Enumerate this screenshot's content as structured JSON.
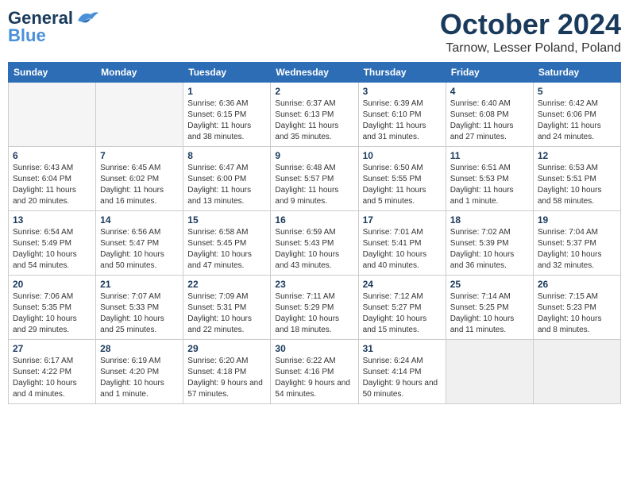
{
  "logo": {
    "line1": "General",
    "line2": "Blue"
  },
  "title": "October 2024",
  "location": "Tarnow, Lesser Poland, Poland",
  "days_of_week": [
    "Sunday",
    "Monday",
    "Tuesday",
    "Wednesday",
    "Thursday",
    "Friday",
    "Saturday"
  ],
  "weeks": [
    [
      {
        "day": "",
        "info": ""
      },
      {
        "day": "",
        "info": ""
      },
      {
        "day": "1",
        "info": "Sunrise: 6:36 AM\nSunset: 6:15 PM\nDaylight: 11 hours and 38 minutes."
      },
      {
        "day": "2",
        "info": "Sunrise: 6:37 AM\nSunset: 6:13 PM\nDaylight: 11 hours and 35 minutes."
      },
      {
        "day": "3",
        "info": "Sunrise: 6:39 AM\nSunset: 6:10 PM\nDaylight: 11 hours and 31 minutes."
      },
      {
        "day": "4",
        "info": "Sunrise: 6:40 AM\nSunset: 6:08 PM\nDaylight: 11 hours and 27 minutes."
      },
      {
        "day": "5",
        "info": "Sunrise: 6:42 AM\nSunset: 6:06 PM\nDaylight: 11 hours and 24 minutes."
      }
    ],
    [
      {
        "day": "6",
        "info": "Sunrise: 6:43 AM\nSunset: 6:04 PM\nDaylight: 11 hours and 20 minutes."
      },
      {
        "day": "7",
        "info": "Sunrise: 6:45 AM\nSunset: 6:02 PM\nDaylight: 11 hours and 16 minutes."
      },
      {
        "day": "8",
        "info": "Sunrise: 6:47 AM\nSunset: 6:00 PM\nDaylight: 11 hours and 13 minutes."
      },
      {
        "day": "9",
        "info": "Sunrise: 6:48 AM\nSunset: 5:57 PM\nDaylight: 11 hours and 9 minutes."
      },
      {
        "day": "10",
        "info": "Sunrise: 6:50 AM\nSunset: 5:55 PM\nDaylight: 11 hours and 5 minutes."
      },
      {
        "day": "11",
        "info": "Sunrise: 6:51 AM\nSunset: 5:53 PM\nDaylight: 11 hours and 1 minute."
      },
      {
        "day": "12",
        "info": "Sunrise: 6:53 AM\nSunset: 5:51 PM\nDaylight: 10 hours and 58 minutes."
      }
    ],
    [
      {
        "day": "13",
        "info": "Sunrise: 6:54 AM\nSunset: 5:49 PM\nDaylight: 10 hours and 54 minutes."
      },
      {
        "day": "14",
        "info": "Sunrise: 6:56 AM\nSunset: 5:47 PM\nDaylight: 10 hours and 50 minutes."
      },
      {
        "day": "15",
        "info": "Sunrise: 6:58 AM\nSunset: 5:45 PM\nDaylight: 10 hours and 47 minutes."
      },
      {
        "day": "16",
        "info": "Sunrise: 6:59 AM\nSunset: 5:43 PM\nDaylight: 10 hours and 43 minutes."
      },
      {
        "day": "17",
        "info": "Sunrise: 7:01 AM\nSunset: 5:41 PM\nDaylight: 10 hours and 40 minutes."
      },
      {
        "day": "18",
        "info": "Sunrise: 7:02 AM\nSunset: 5:39 PM\nDaylight: 10 hours and 36 minutes."
      },
      {
        "day": "19",
        "info": "Sunrise: 7:04 AM\nSunset: 5:37 PM\nDaylight: 10 hours and 32 minutes."
      }
    ],
    [
      {
        "day": "20",
        "info": "Sunrise: 7:06 AM\nSunset: 5:35 PM\nDaylight: 10 hours and 29 minutes."
      },
      {
        "day": "21",
        "info": "Sunrise: 7:07 AM\nSunset: 5:33 PM\nDaylight: 10 hours and 25 minutes."
      },
      {
        "day": "22",
        "info": "Sunrise: 7:09 AM\nSunset: 5:31 PM\nDaylight: 10 hours and 22 minutes."
      },
      {
        "day": "23",
        "info": "Sunrise: 7:11 AM\nSunset: 5:29 PM\nDaylight: 10 hours and 18 minutes."
      },
      {
        "day": "24",
        "info": "Sunrise: 7:12 AM\nSunset: 5:27 PM\nDaylight: 10 hours and 15 minutes."
      },
      {
        "day": "25",
        "info": "Sunrise: 7:14 AM\nSunset: 5:25 PM\nDaylight: 10 hours and 11 minutes."
      },
      {
        "day": "26",
        "info": "Sunrise: 7:15 AM\nSunset: 5:23 PM\nDaylight: 10 hours and 8 minutes."
      }
    ],
    [
      {
        "day": "27",
        "info": "Sunrise: 6:17 AM\nSunset: 4:22 PM\nDaylight: 10 hours and 4 minutes."
      },
      {
        "day": "28",
        "info": "Sunrise: 6:19 AM\nSunset: 4:20 PM\nDaylight: 10 hours and 1 minute."
      },
      {
        "day": "29",
        "info": "Sunrise: 6:20 AM\nSunset: 4:18 PM\nDaylight: 9 hours and 57 minutes."
      },
      {
        "day": "30",
        "info": "Sunrise: 6:22 AM\nSunset: 4:16 PM\nDaylight: 9 hours and 54 minutes."
      },
      {
        "day": "31",
        "info": "Sunrise: 6:24 AM\nSunset: 4:14 PM\nDaylight: 9 hours and 50 minutes."
      },
      {
        "day": "",
        "info": ""
      },
      {
        "day": "",
        "info": ""
      }
    ]
  ]
}
